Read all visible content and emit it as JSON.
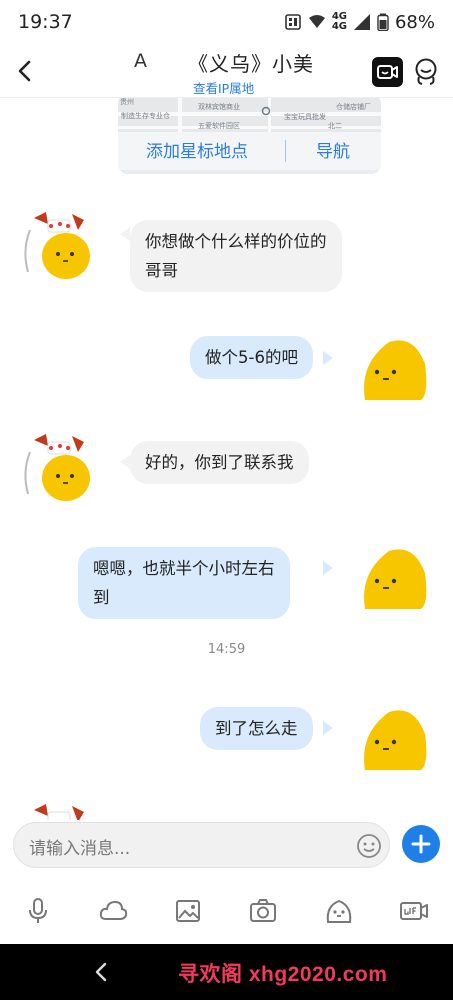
{
  "status_bar": {
    "time": "19:37",
    "network_1": "4G",
    "network_2": "4G",
    "battery": "68%"
  },
  "header": {
    "contact_initial": "A",
    "title": "《义乌》小美",
    "ip_link": "查看IP属地"
  },
  "map_card": {
    "labels": [
      "双林宾馆商业",
      "制造生存专业仓",
      "五爱软件园区",
      "宝宝玩具批发",
      "仓储店铺厂",
      "贵州",
      "北二"
    ],
    "add_star_label": "添加星标地点",
    "navigate_label": "导航"
  },
  "messages": [
    {
      "direction": "in",
      "text_lines": [
        "你想做个什么样的价位的",
        "哥哥"
      ]
    },
    {
      "direction": "out",
      "text_lines": [
        "做个5-6的吧"
      ]
    },
    {
      "direction": "in",
      "text_lines": [
        "好的，你到了联系我"
      ]
    },
    {
      "direction": "out",
      "text_lines": [
        "嗯嗯，也就半个小时左右",
        "到"
      ]
    },
    {
      "direction": "out",
      "text_lines": [
        "到了怎么走"
      ]
    }
  ],
  "timestamp": "14:59",
  "input": {
    "placeholder": "请输入消息..."
  },
  "toolbar": {
    "icons": [
      "microphone-icon",
      "cloud-icon",
      "image-icon",
      "camera-icon",
      "sticker-icon",
      "gif-icon"
    ]
  },
  "watermark": "寻欢阁 xhg2020.com",
  "colors": {
    "accent": "#1e7fe6",
    "incoming_bubble": "#f2f2f2",
    "outgoing_bubble": "#d8eafc",
    "avatar_yellow": "#f7c600",
    "watermark": "#f23a5b"
  }
}
